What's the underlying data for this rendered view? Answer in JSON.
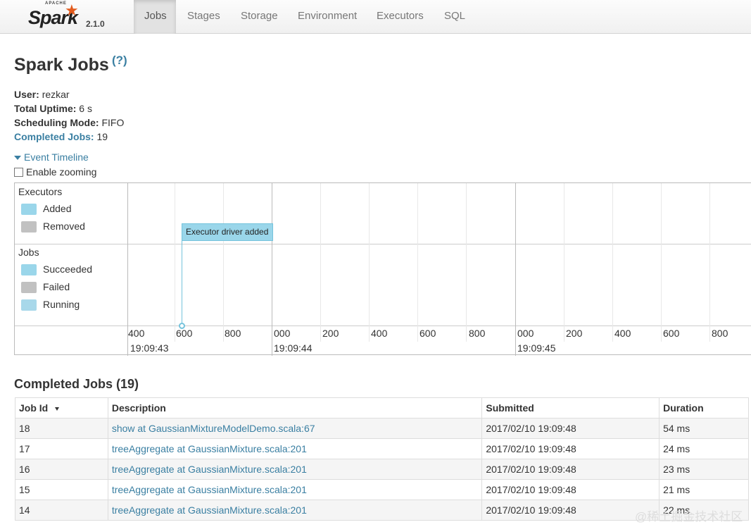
{
  "brand": {
    "apache": "APACHE",
    "name": "Spark",
    "version": "2.1.0"
  },
  "nav": {
    "tabs": [
      {
        "label": "Jobs",
        "active": true
      },
      {
        "label": "Stages"
      },
      {
        "label": "Storage"
      },
      {
        "label": "Environment"
      },
      {
        "label": "Executors"
      },
      {
        "label": "SQL"
      }
    ]
  },
  "page": {
    "title": "Spark Jobs",
    "help": "(?)"
  },
  "info": {
    "user_label": "User:",
    "user": "rezkar",
    "uptime_label": "Total Uptime:",
    "uptime": "6 s",
    "scheduling_label": "Scheduling Mode:",
    "scheduling": "FIFO",
    "completed_label": "Completed Jobs:",
    "completed": "19"
  },
  "timeline": {
    "toggle": "Event Timeline",
    "zoom_label": "Enable zooming",
    "executors": {
      "title": "Executors",
      "added": "Added",
      "removed": "Removed"
    },
    "jobs": {
      "title": "Jobs",
      "succeeded": "Succeeded",
      "failed": "Failed",
      "running": "Running"
    },
    "event_label": "Executor driver added",
    "ticks": [
      "400",
      "600",
      "800",
      "000",
      "200",
      "400",
      "600",
      "800",
      "000",
      "200",
      "400",
      "600",
      "800"
    ],
    "times": [
      "19:09:43",
      "19:09:44",
      "19:09:45"
    ],
    "colors": {
      "added": "#9ad6ea",
      "removed": "#c1c1c1",
      "succeeded": "#9ad6ea",
      "failed": "#c1c1c1",
      "running": "#a8d8ea"
    }
  },
  "completed_section": {
    "title": "Completed Jobs (19)",
    "columns": [
      "Job Id",
      "Description",
      "Submitted",
      "Duration"
    ],
    "rows": [
      {
        "id": "18",
        "description": "show at GaussianMixtureModelDemo.scala:67",
        "submitted": "2017/02/10 19:09:48",
        "duration": "54 ms"
      },
      {
        "id": "17",
        "description": "treeAggregate at GaussianMixture.scala:201",
        "submitted": "2017/02/10 19:09:48",
        "duration": "24 ms"
      },
      {
        "id": "16",
        "description": "treeAggregate at GaussianMixture.scala:201",
        "submitted": "2017/02/10 19:09:48",
        "duration": "23 ms"
      },
      {
        "id": "15",
        "description": "treeAggregate at GaussianMixture.scala:201",
        "submitted": "2017/02/10 19:09:48",
        "duration": "21 ms"
      },
      {
        "id": "14",
        "description": "treeAggregate at GaussianMixture.scala:201",
        "submitted": "2017/02/10 19:09:48",
        "duration": "22 ms"
      }
    ]
  },
  "watermark": "@稀土掘金技术社区"
}
